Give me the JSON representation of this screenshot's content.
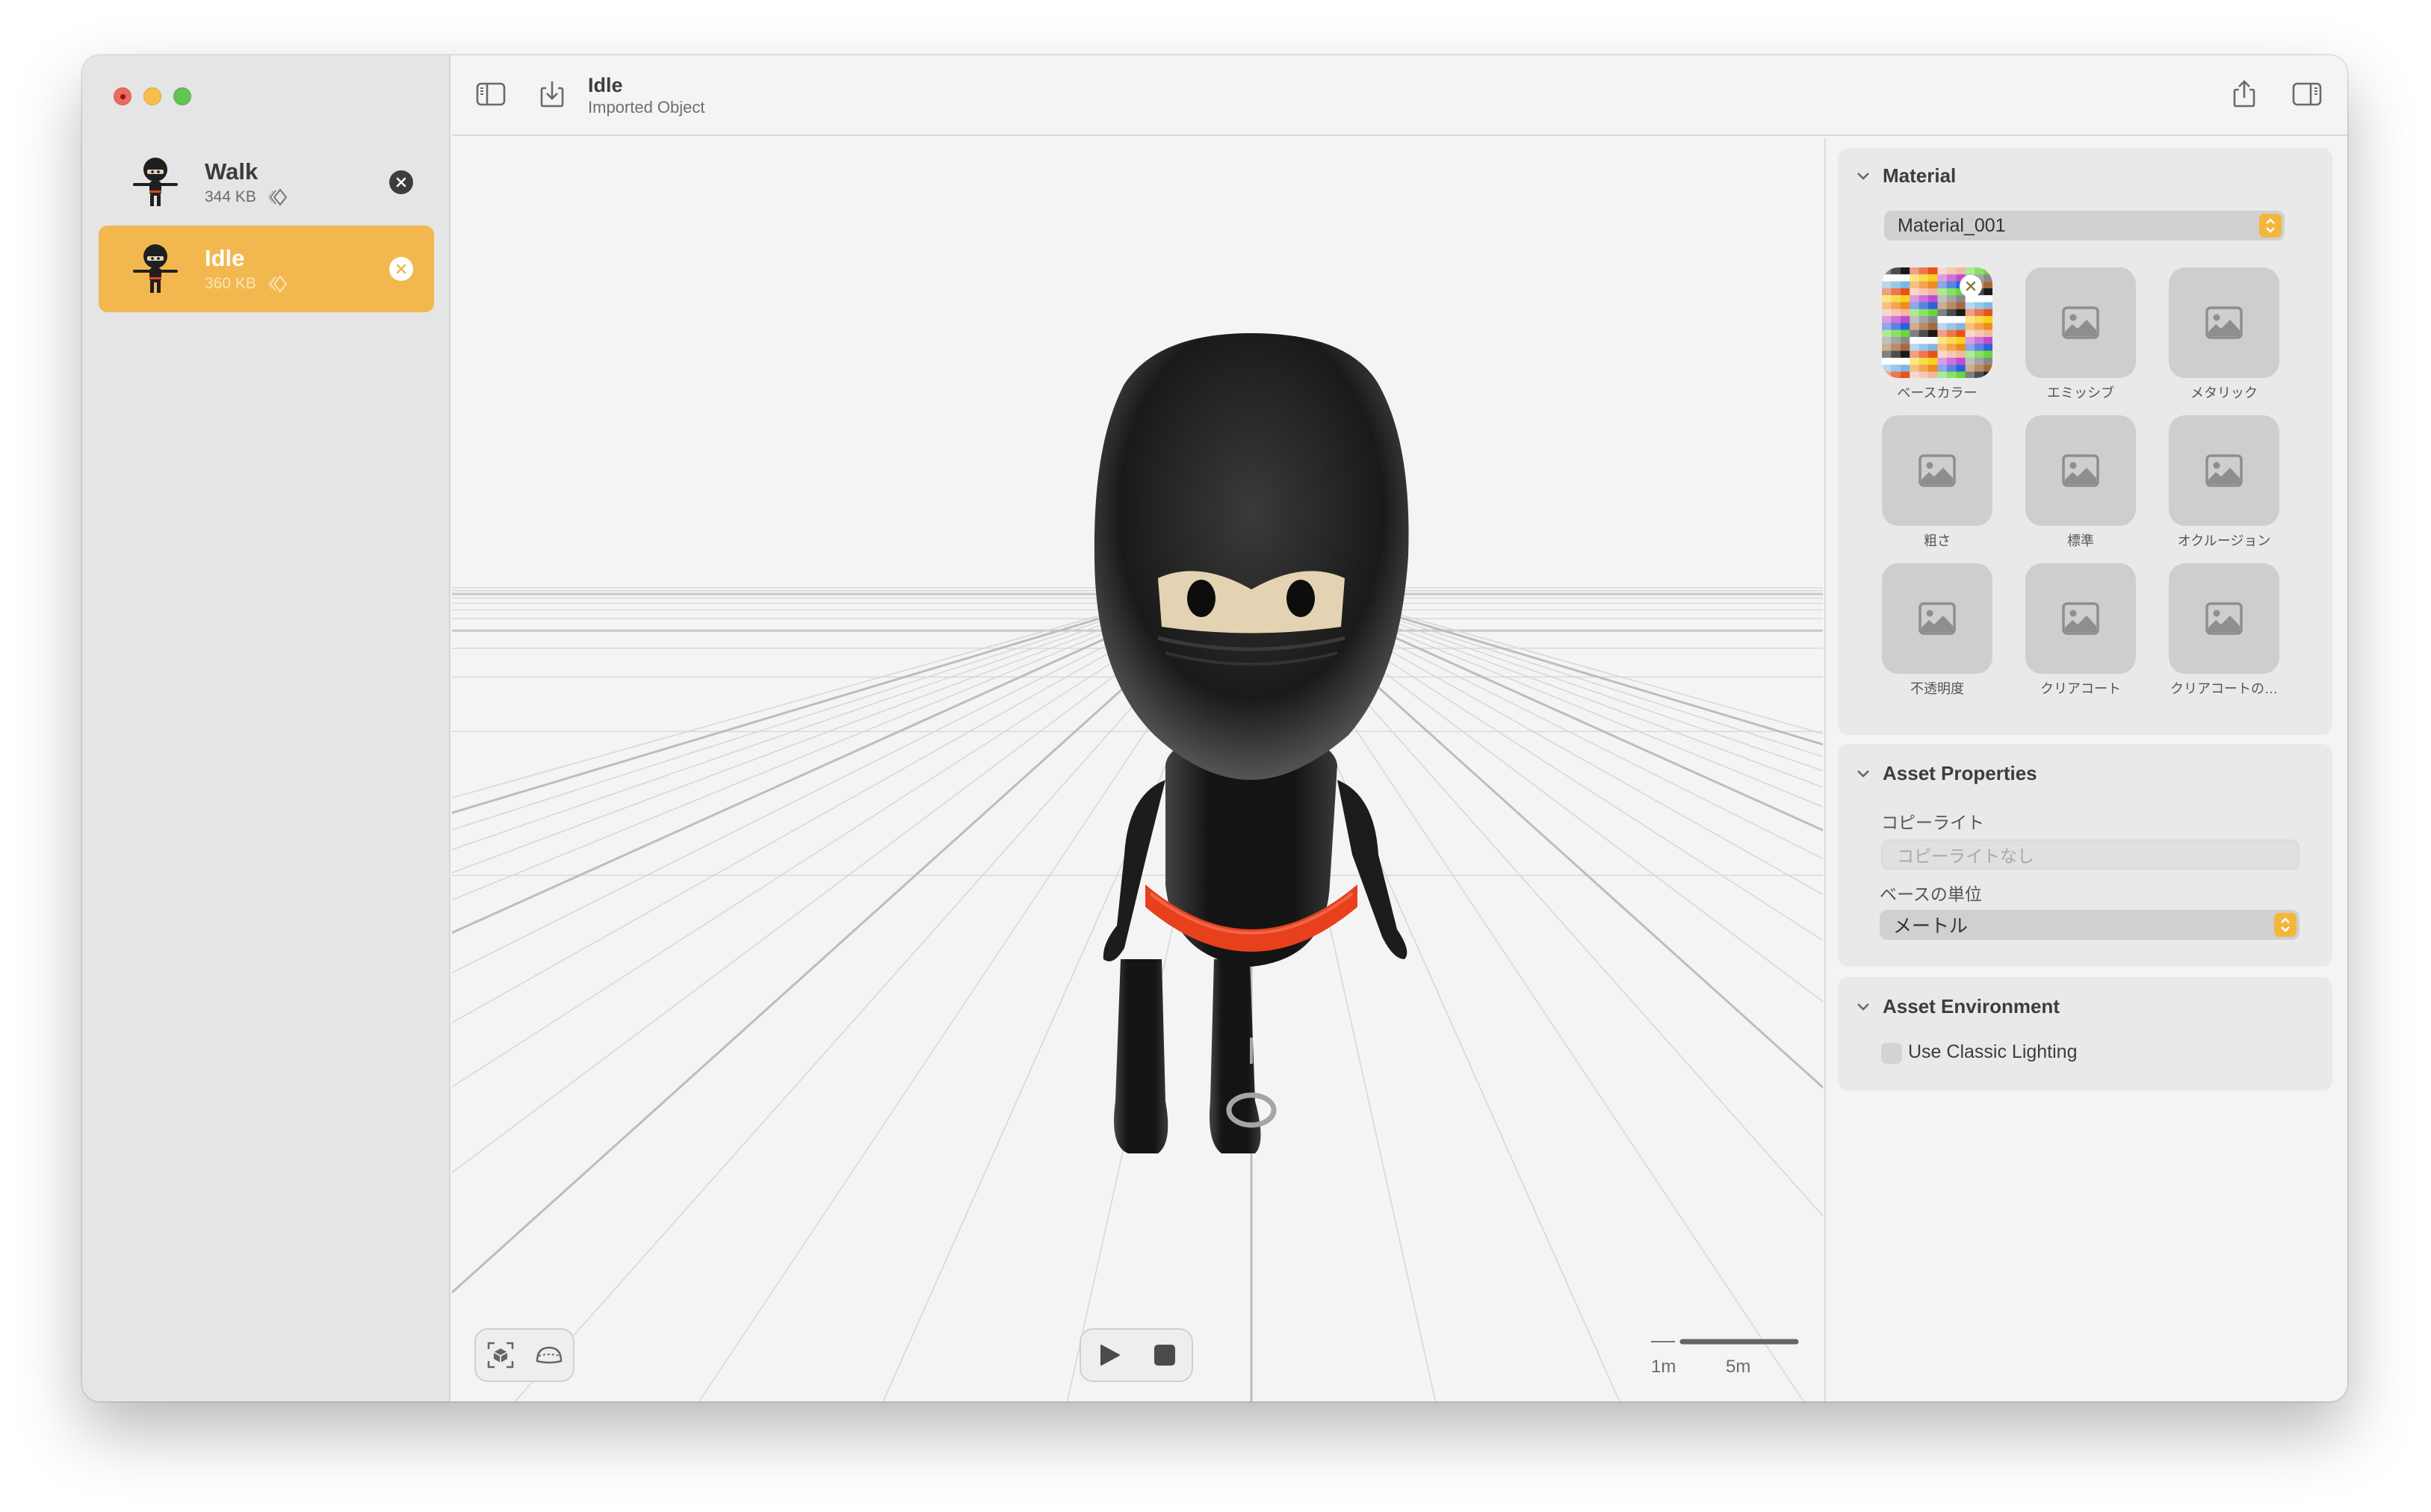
{
  "window": {
    "traffic_lights": [
      "close",
      "minimize",
      "zoom"
    ]
  },
  "sidebar": {
    "items": [
      {
        "name": "Walk",
        "size": "344 KB",
        "icon": "motion-icon",
        "selected": false
      },
      {
        "name": "Idle",
        "size": "360 KB",
        "icon": "motion-icon",
        "selected": true
      }
    ]
  },
  "header": {
    "title": "Idle",
    "subtitle": "Imported Object",
    "left_icons": [
      "sidebar-toggle-icon",
      "import-icon"
    ],
    "right_icons": [
      "share-icon",
      "inspector-toggle-icon"
    ]
  },
  "viewport": {
    "left_controls": [
      "frame-object-icon",
      "environment-dome-icon"
    ],
    "playback": [
      "play-icon",
      "stop-icon"
    ],
    "scale": {
      "small_label": "1m",
      "large_label": "5m"
    }
  },
  "inspector": {
    "material": {
      "title": "Material",
      "selected_material": "Material_001",
      "textures": [
        {
          "label": "ベースカラー",
          "has_texture": true
        },
        {
          "label": "エミッシブ",
          "has_texture": false
        },
        {
          "label": "メタリック",
          "has_texture": false
        },
        {
          "label": "粗さ",
          "has_texture": false
        },
        {
          "label": "標準",
          "has_texture": false
        },
        {
          "label": "オクルージョン",
          "has_texture": false
        },
        {
          "label": "不透明度",
          "has_texture": false
        },
        {
          "label": "クリアコート",
          "has_texture": false
        },
        {
          "label": "クリアコートの…",
          "has_texture": false
        }
      ]
    },
    "asset_properties": {
      "title": "Asset Properties",
      "copyright_label": "コピーライト",
      "copyright_placeholder": "コピーライトなし",
      "copyright_value": "",
      "base_unit_label": "ベースの単位",
      "base_unit_value": "メートル"
    },
    "asset_environment": {
      "title": "Asset Environment",
      "classic_lighting_label": "Use Classic Lighting",
      "classic_lighting_checked": false
    }
  },
  "colors": {
    "accent": "#f2b84f",
    "stepper": "#f3b63d",
    "sash": "#e8401c"
  }
}
